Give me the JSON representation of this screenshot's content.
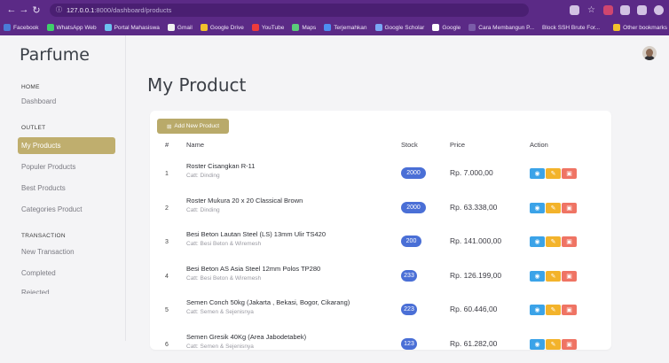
{
  "browser": {
    "url_host": "127.0.0.1",
    "url_path": ":8000/dashboard/products",
    "bookmarks": [
      "Facebook",
      "WhatsApp Web",
      "Portal Mahasiswa",
      "Gmail",
      "Google Drive",
      "YouTube",
      "Maps",
      "Terjemahkan",
      "Google Scholar",
      "Google",
      "Cara Membangun P...",
      "Block SSH Brute For..."
    ],
    "other_bookmarks": "Other bookmarks"
  },
  "sidebar": {
    "brand": "Parfume",
    "home_section": "HOME",
    "dashboard": "Dashboard",
    "outlet_section": "OUTLET",
    "outlet_items": [
      "My Products",
      "Populer Products",
      "Best Products",
      "Categories Product"
    ],
    "transaction_section": "TRANSACTION",
    "transaction_items": [
      "New Transaction",
      "Completed",
      "Rejected"
    ]
  },
  "main": {
    "title": "My Product",
    "add_button": "Add New Product",
    "columns": {
      "num": "#",
      "name": "Name",
      "stock": "Stock",
      "price": "Price",
      "action": "Action"
    },
    "rows": [
      {
        "num": "1",
        "name": "Roster Cisangkan R-11",
        "category": "Catt: Dinding",
        "stock": "2000",
        "price": "Rp. 7.000,00"
      },
      {
        "num": "2",
        "name": "Roster Mukura 20 x 20 Classical Brown",
        "category": "Catt: Dinding",
        "stock": "2000",
        "price": "Rp. 63.338,00"
      },
      {
        "num": "3",
        "name": "Besi Beton Lautan Steel (LS) 13mm Ulir TS420",
        "category": "Catt: Besi Beton & Wiremesh",
        "stock": "200",
        "price": "Rp. 141.000,00"
      },
      {
        "num": "4",
        "name": "Besi Beton AS Asia Steel 12mm Polos TP280",
        "category": "Catt: Besi Beton & Wiremesh",
        "stock": "233",
        "price": "Rp. 126.199,00"
      },
      {
        "num": "5",
        "name": "Semen Conch 50kg (Jakarta , Bekasi, Bogor, Cikarang)",
        "category": "Catt: Semen & Sejenisnya",
        "stock": "223",
        "price": "Rp. 60.446,00"
      },
      {
        "num": "6",
        "name": "Semen Gresik 40Kg (Area Jabodetabek)",
        "category": "Catt: Semen & Sejenisnya",
        "stock": "123",
        "price": "Rp. 61.282,00"
      }
    ]
  },
  "colors": {
    "sidebar_active": "#bfae6e",
    "add_button": "#b9aa6a",
    "stock_badge": "#4a6fd6",
    "view": "#3ba3e8",
    "edit": "#f3b32b",
    "delete": "#ef7464",
    "browser": "#5b2a86"
  }
}
